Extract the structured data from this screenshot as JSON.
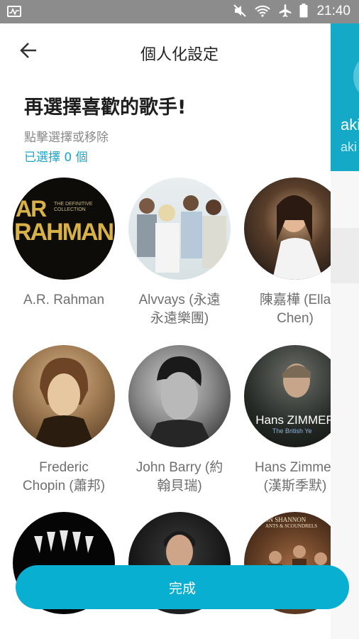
{
  "status_bar": {
    "time": "21:40",
    "icons": [
      "mute-icon",
      "wifi-icon",
      "airplane-icon",
      "battery-icon"
    ]
  },
  "header": {
    "title": "個人化設定",
    "back_icon": "arrow-left-icon"
  },
  "intro": {
    "headline": "再選擇喜歡的歌手!",
    "hint": "點擊選擇或移除",
    "selected_count": "已選擇 0 個"
  },
  "artists": [
    {
      "name": "A.R. Rahman",
      "image": "album-cover-ar-rahman",
      "art_line1": "AR",
      "art_line2": "RAHMAN",
      "art_small": "THE DEFINITIVE COLLECTION"
    },
    {
      "name": "Alvvays (永遠\n永遠樂團)",
      "image": "band-photo-alvvays"
    },
    {
      "name": "陳嘉樺 (Ella\nChen)",
      "image": "portrait-ella-chen"
    },
    {
      "name": "Frederic\nChopin (蕭邦)",
      "image": "portrait-chopin"
    },
    {
      "name": "John Barry (約\n翰貝瑞)",
      "image": "portrait-john-barry"
    },
    {
      "name": "Hans Zimmer\n(漢斯季默)",
      "image": "album-cover-hans-zimmer",
      "art_line1": "Hans ZIMMER",
      "art_small": "The British Ye"
    },
    {
      "name": "",
      "image": "album-cover-claws"
    },
    {
      "name": "",
      "image": "portrait-singer"
    },
    {
      "name": "",
      "image": "album-cover-shannon",
      "art_line1": "ON SHANNON",
      "art_small": "ANTS & SCOUNDRELS"
    }
  ],
  "peek_panel": {
    "line1": "aki",
    "line2": "aki"
  },
  "done_button": {
    "label": "完成"
  },
  "colors": {
    "accent": "#08afd1",
    "status_bar": "#8c8c8c",
    "peek_panel": "#15a9c8"
  }
}
